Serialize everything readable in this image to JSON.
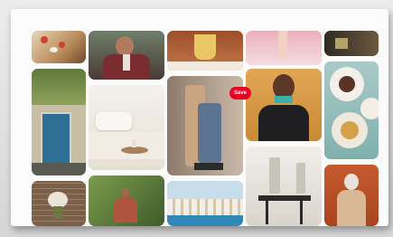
{
  "grid": {
    "pins": [
      {
        "name": "food-pin"
      },
      {
        "name": "suit-man-pin"
      },
      {
        "name": "drink-pin"
      },
      {
        "name": "pink-fashion-pin"
      },
      {
        "name": "dark-interior-pin"
      },
      {
        "name": "blue-door-pin"
      },
      {
        "name": "white-bedroom-pin"
      },
      {
        "name": "trench-coat-pin"
      },
      {
        "name": "portrait-woman-pin"
      },
      {
        "name": "dessert-plates-pin"
      },
      {
        "name": "white-tables-pin"
      },
      {
        "name": "brick-flower-pin"
      },
      {
        "name": "garden-woman-pin"
      },
      {
        "name": "coastal-town-pin"
      },
      {
        "name": "rust-woman-pin"
      }
    ],
    "save_label": "Save",
    "accent": "#e60023"
  }
}
